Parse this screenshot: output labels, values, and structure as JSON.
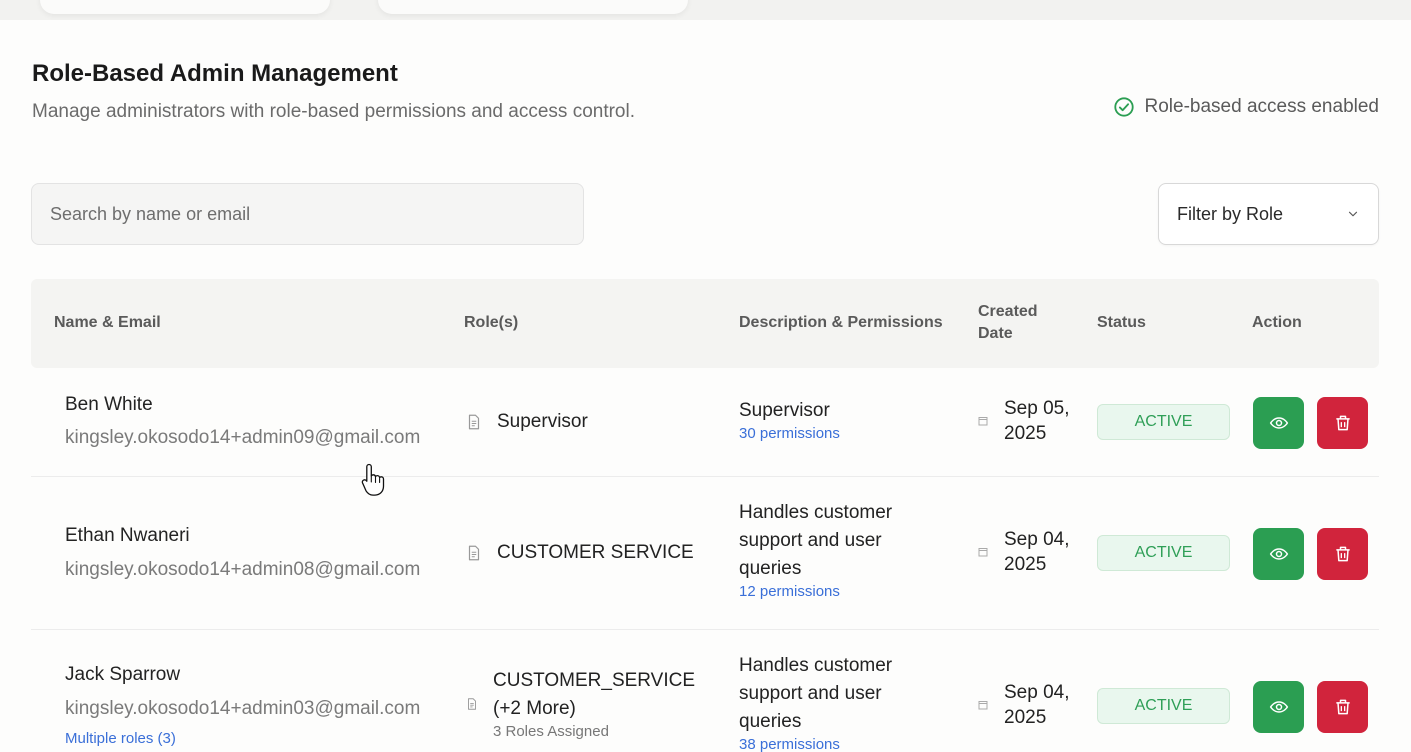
{
  "header": {
    "title": "Role-Based Admin Management",
    "subtitle": "Manage administrators with role-based permissions and access control.",
    "rbac_status": "Role-based access enabled",
    "rbac_icon": "check-circle-icon"
  },
  "search": {
    "placeholder": "Search by name or email",
    "value": ""
  },
  "filter": {
    "label": "Filter by Role",
    "icon": "chevron-down-icon"
  },
  "table": {
    "columns": {
      "name_email": "Name & Email",
      "roles": "Role(s)",
      "desc": "Description & Permissions",
      "created_line1": "Created",
      "created_line2": "Date",
      "status": "Status",
      "action": "Action"
    },
    "rows": [
      {
        "name": "Ben White",
        "email": "kingsley.okosodo14+admin09@gmail.com",
        "multi": "",
        "role": "Supervisor",
        "role_line2": "",
        "role_sub": "",
        "desc": [
          "Supervisor"
        ],
        "permissions": "30 permissions",
        "date_line1": "Sep 05,",
        "date_line2": "2025",
        "status": "ACTIVE"
      },
      {
        "name": "Ethan Nwaneri",
        "email": "kingsley.okosodo14+admin08@gmail.com",
        "multi": "",
        "role": "CUSTOMER SERVICE",
        "role_line2": "",
        "role_sub": "",
        "desc": [
          "Handles customer",
          "support and user",
          "queries"
        ],
        "permissions": "12 permissions",
        "date_line1": "Sep 04,",
        "date_line2": "2025",
        "status": "ACTIVE"
      },
      {
        "name": "Jack Sparrow",
        "email": "kingsley.okosodo14+admin03@gmail.com",
        "multi": "Multiple roles (3)",
        "role": "CUSTOMER_SERVICE",
        "role_line2": "(+2 More)",
        "role_sub": "3 Roles Assigned",
        "desc": [
          "Handles customer",
          "support and user",
          "queries"
        ],
        "permissions": "38 permissions",
        "date_line1": "Sep 04,",
        "date_line2": "2025",
        "status": "ACTIVE"
      }
    ]
  },
  "colors": {
    "accent_green": "#2b9e52",
    "danger_red": "#d1243c",
    "link_blue": "#3a6fd8",
    "status_bg": "#e9f7ee"
  }
}
